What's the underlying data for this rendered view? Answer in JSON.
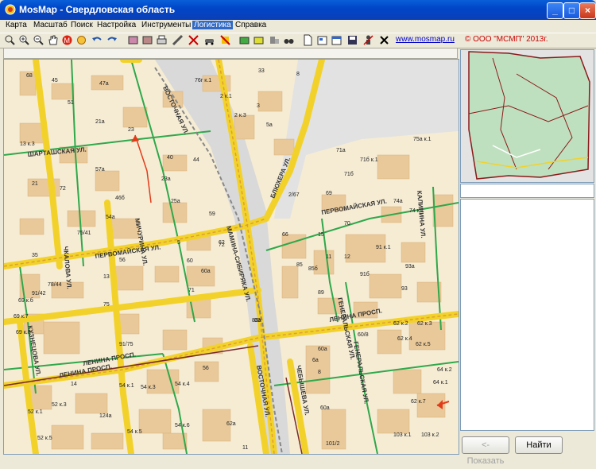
{
  "window": {
    "title": "MosMap - Свердловская область"
  },
  "menu": [
    "Карта",
    "Масштаб",
    "Поиск",
    "Настройка",
    "Инструменты",
    "Логистика",
    "Справка"
  ],
  "toolbar": {
    "link": "www.mosmap.ru",
    "copyright": "© ООО \"МСМП\" 2013г."
  },
  "buttons": {
    "show": "<- Показать",
    "find": "Найти"
  },
  "map": {
    "streets": [
      "ШАРТАШСКАЯ УЛ.",
      "ВОСТОЧНАЯ УЛ.",
      "БЛЮХЕРА УЛ.",
      "ПЕРВОМАЙСКАЯ УЛ.",
      "ПЕРВОМАЙСКАЯ УЛ.",
      "МИЧУРИНА УЛ.",
      "ЧКАЛОВА УЛ.",
      "МАМИНА-СИБИРЯКА УЛ.",
      "ГЕНЕРАЛЬСКАЯ УЛ.",
      "ЛЕНИНА ПРОСП.",
      "ЛЕНИНА ПРОСП.",
      "ЛЕНИНА ПРОСП.",
      "КУЗНЕЦОВА УЛ.",
      "ВОСТОЧНАЯ УЛ.",
      "ЧЕБЫШЕВА УЛ.",
      "ГЕНЕРАЛЬСКАЯ УЛ.",
      "КАЛИНИНА УЛ."
    ],
    "houses": [
      "68",
      "45",
      "47а",
      "76г к.1",
      "33",
      "8",
      "51",
      "2 к.1",
      "21а",
      "3",
      "23",
      "2 к.3",
      "13 к.3",
      "5а",
      "75а к.1",
      "71а",
      "40",
      "71б к.1",
      "57а",
      "23а",
      "44",
      "71б",
      "72",
      "21",
      "2/67",
      "69",
      "74а",
      "74 к.1",
      "46б",
      "54а",
      "25а",
      "59",
      "72",
      "66",
      "15",
      "70",
      "75/41",
      "5",
      "62",
      "91 к.1",
      "35",
      "56",
      "60",
      "60а",
      "11",
      "12",
      "85",
      "85б",
      "91б",
      "93а",
      "78/44",
      "13",
      "71",
      "83",
      "89",
      "93",
      "91/42",
      "69 к.б",
      "75",
      "60/8",
      "69 к.7",
      "62 к.2",
      "62 к.3",
      "69 к.8",
      "91/75",
      "83а",
      "60а",
      "62 к.4",
      "62 к.5",
      "56",
      "54 к.1",
      "54 к.3",
      "54 к.4",
      "6а",
      "8",
      "62 к.7",
      "60а",
      "52 к.3",
      "52 к.1",
      "14",
      "54 к.5",
      "54 к.6",
      "62а",
      "11",
      "124а",
      "101/2",
      "103 к.1",
      "103 к.2",
      "64 к.1",
      "64 к.2",
      "52 к.5"
    ]
  }
}
